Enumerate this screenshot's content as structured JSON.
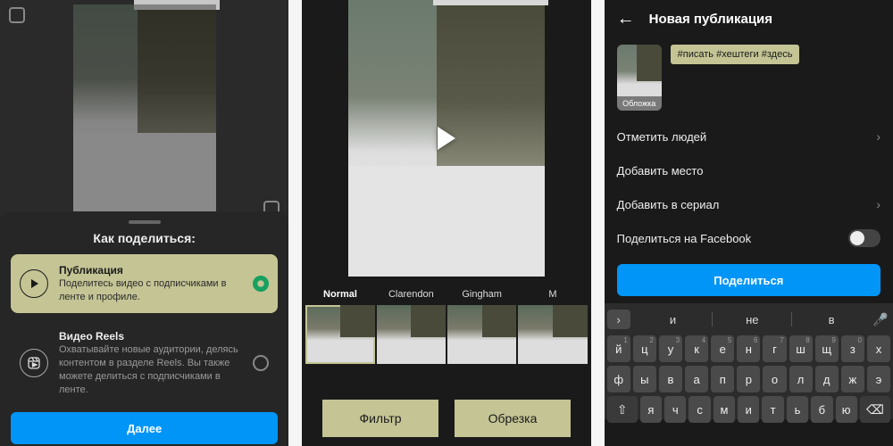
{
  "colors": {
    "highlight": "#c4c495",
    "primary": "#0095f6"
  },
  "phone1": {
    "sheet_title": "Как поделиться:",
    "option_post": {
      "title": "Публикация",
      "desc": "Поделитесь видео с подписчиками в ленте и профиле."
    },
    "option_reels": {
      "title": "Видео Reels",
      "desc": "Охватывайте новые аудитории, делясь контентом в разделе Reels. Вы также можете делиться с подписчиками в ленте."
    },
    "next_btn": "Далее"
  },
  "phone2": {
    "filters": [
      {
        "name": "Normal",
        "active": true
      },
      {
        "name": "Clarendon",
        "active": false
      },
      {
        "name": "Gingham",
        "active": false
      },
      {
        "name": "M",
        "active": false
      }
    ],
    "tab_filter": "Фильтр",
    "tab_crop": "Обрезка"
  },
  "phone3": {
    "title": "Новая публикация",
    "cover_label": "Обложка",
    "hashtags": "#писать #хештеги #здесь",
    "row_tag_people": "Отметить людей",
    "row_add_place": "Добавить место",
    "row_add_series": "Добавить в сериал",
    "row_share_fb": "Поделиться на Facebook",
    "share_btn": "Поделиться",
    "suggestions": [
      "и",
      "не",
      "в"
    ],
    "keys_r1": [
      "й",
      "ц",
      "у",
      "к",
      "е",
      "н",
      "г",
      "ш",
      "щ",
      "з",
      "х"
    ],
    "keys_r1_sup": [
      "1",
      "2",
      "3",
      "4",
      "5",
      "6",
      "7",
      "8",
      "9",
      "0",
      ""
    ],
    "keys_r2": [
      "ф",
      "ы",
      "в",
      "а",
      "п",
      "р",
      "о",
      "л",
      "д",
      "ж",
      "э"
    ],
    "keys_r3": [
      "я",
      "ч",
      "с",
      "м",
      "и",
      "т",
      "ь",
      "б",
      "ю"
    ]
  }
}
